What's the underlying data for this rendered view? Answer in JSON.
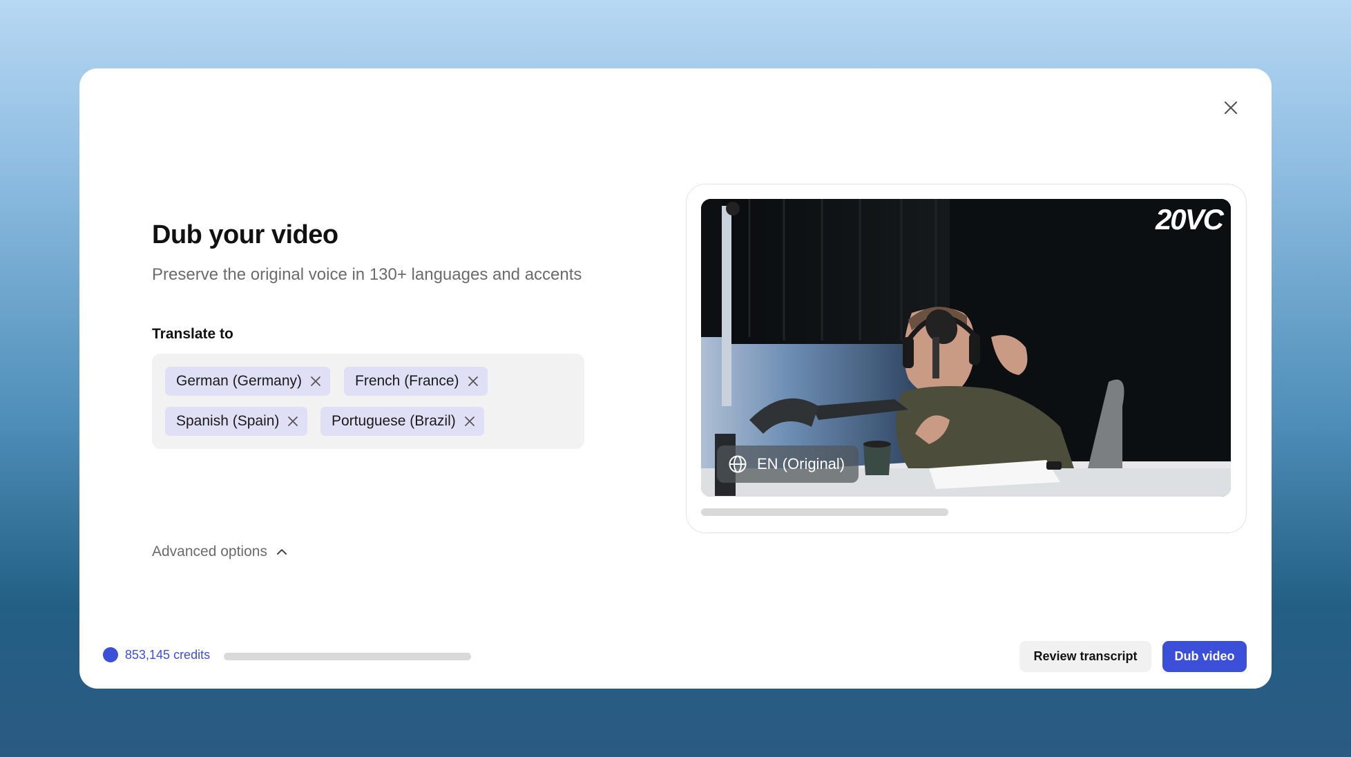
{
  "dialog": {
    "title": "Dub your video",
    "subtitle": "Preserve the original voice in 130+ languages and accents",
    "close_icon": "close-icon"
  },
  "translate": {
    "label": "Translate to",
    "languages": [
      {
        "label": "German (Germany)",
        "remove_icon": "close-icon"
      },
      {
        "label": "French (France)",
        "remove_icon": "close-icon"
      },
      {
        "label": "Spanish (Spain)",
        "remove_icon": "close-icon"
      },
      {
        "label": "Portuguese (Brazil)",
        "remove_icon": "close-icon"
      }
    ]
  },
  "advanced": {
    "label": "Advanced options",
    "icon": "chevron-up-icon"
  },
  "preview": {
    "brand": "20VC",
    "language_chip": "EN (Original)",
    "language_icon": "globe-icon"
  },
  "footer": {
    "credits": "853,145 credits",
    "review_label": "Review transcript",
    "dub_label": "Dub video"
  },
  "colors": {
    "accent": "#3b4fd8",
    "tag_bg": "#dfe0f6",
    "field_bg": "#f2f2f2"
  }
}
